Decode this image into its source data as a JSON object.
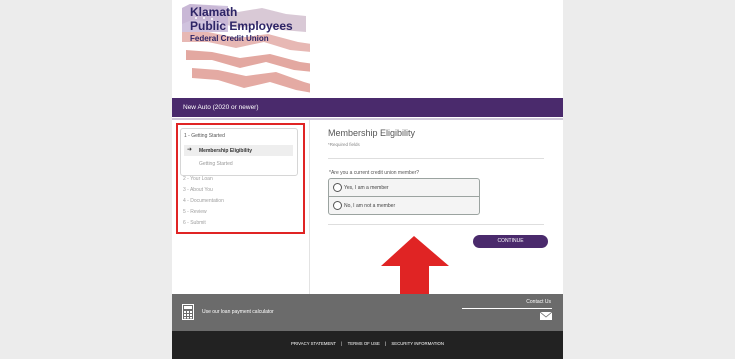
{
  "logo": {
    "line1": "Klamath",
    "line2": "Public Employees",
    "line3": "Federal Credit Union"
  },
  "loan_bar": {
    "title": "New Auto (2020 or newer)"
  },
  "steps": {
    "current_group": "1 - Getting Started",
    "active_item": "Membership Eligibility",
    "sub_item": "Getting Started",
    "items": [
      "2 - Your Loan",
      "3 - About You",
      "4 - Documentation",
      "5 - Review",
      "6 - Submit"
    ]
  },
  "form": {
    "title": "Membership Eligibility",
    "required_note": "*Required fields",
    "question": "*Are you a current credit union member?",
    "options": [
      "Yes, I am a member",
      "No, I am not a member"
    ],
    "continue_label": "CONTINUE"
  },
  "footer": {
    "calculator_text": "Use our loan payment calculator",
    "contact_text": "Contact Us",
    "links": [
      "PRIVACY STATEMENT",
      "TERMS OF USE",
      "SECURITY INFORMATION"
    ],
    "separator": "|"
  },
  "colors": {
    "brand_purple": "#4a2a6c",
    "annotation_red": "#e02424"
  },
  "icons": [
    "arrow-right-icon",
    "radio-icon",
    "calculator-icon",
    "mail-icon",
    "up-arrow-annotation"
  ]
}
